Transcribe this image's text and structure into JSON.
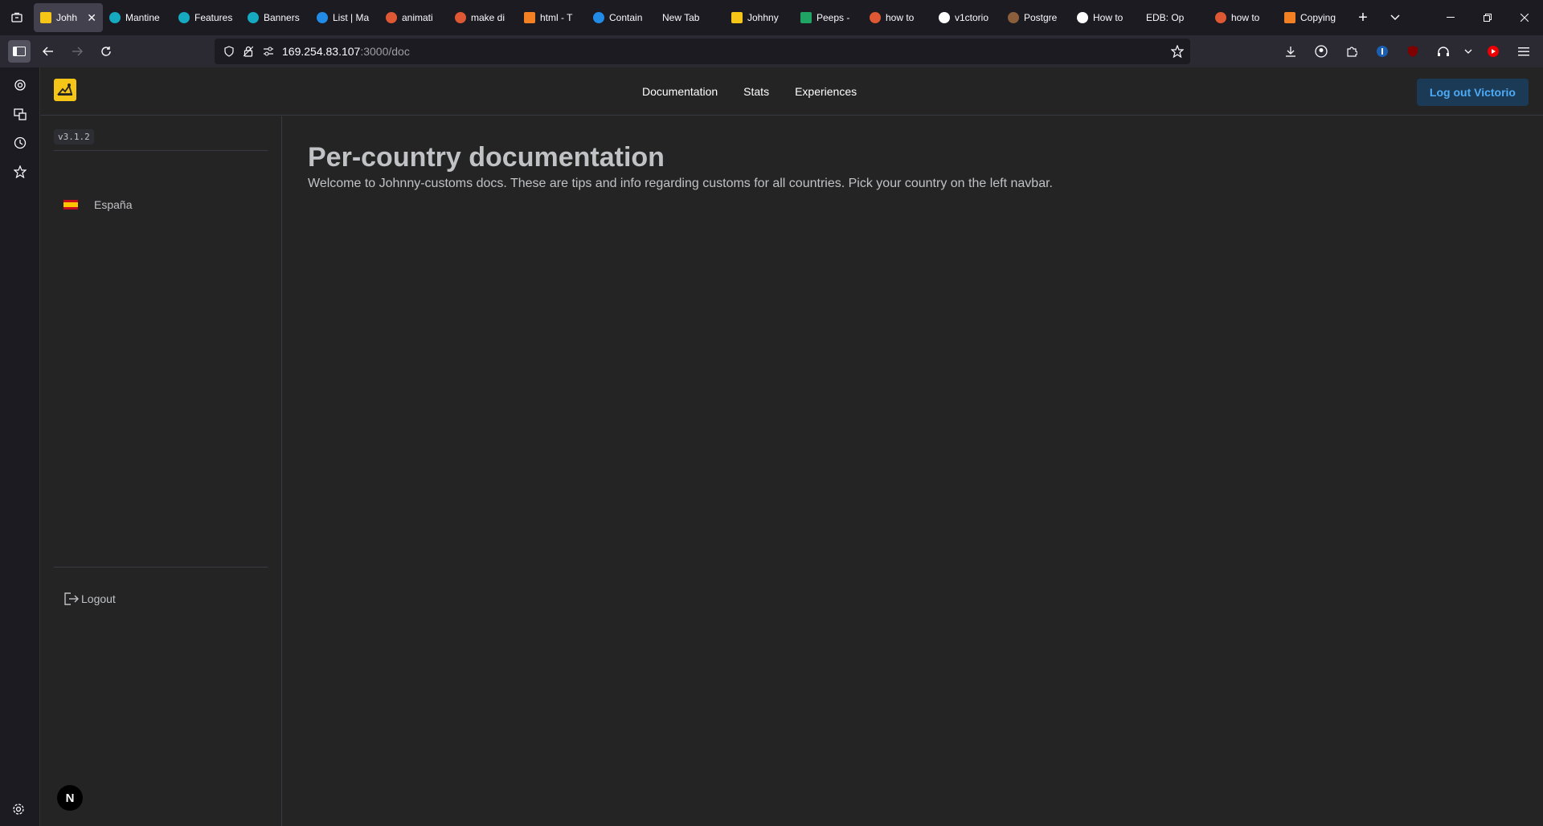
{
  "browser": {
    "tabs": [
      {
        "label": "Johh",
        "active": true,
        "color": "#f5c518"
      },
      {
        "label": "Mantine",
        "color": "#15aabf"
      },
      {
        "label": "Features",
        "color": "#15aabf"
      },
      {
        "label": "Banners",
        "color": "#15aabf"
      },
      {
        "label": "List | Ma",
        "color": "#228be6"
      },
      {
        "label": "animati",
        "color": "#de5833"
      },
      {
        "label": "make di",
        "color": "#de5833"
      },
      {
        "label": "html - T",
        "color": "#f48024"
      },
      {
        "label": "Contain",
        "color": "#228be6"
      },
      {
        "label": "New Tab",
        "color": ""
      },
      {
        "label": "Johhny",
        "color": "#f5c518"
      },
      {
        "label": "Peeps -",
        "color": "#1fa463"
      },
      {
        "label": "how to",
        "color": "#de5833"
      },
      {
        "label": "v1ctorio",
        "color": "#ffffff"
      },
      {
        "label": "Postgre",
        "color": "#8b5e3c"
      },
      {
        "label": "How to",
        "color": "#ffffff"
      },
      {
        "label": "EDB: Op",
        "color": ""
      },
      {
        "label": "how to",
        "color": "#de5833"
      },
      {
        "label": "Copying",
        "color": "#f48024"
      }
    ],
    "tab_close": "✕",
    "new_tab": "+",
    "url_host": "169.254.83.107",
    "url_path": ":3000/doc"
  },
  "header": {
    "menu": [
      "Documentation",
      "Stats",
      "Experiences"
    ],
    "logout_button": "Log out Victorio"
  },
  "docnav": {
    "version": "v3.1.2",
    "countries": [
      "España"
    ],
    "logout": "Logout",
    "badge": "N"
  },
  "main": {
    "title": "Per-country documentation",
    "description": "Welcome to Johnny-customs docs. These are tips and info regarding customs for all countries. Pick your country on the left navbar."
  },
  "colors": {
    "accent": "#4dabf7",
    "button_bg": "#1b3a55",
    "logo": "#f5c518"
  }
}
